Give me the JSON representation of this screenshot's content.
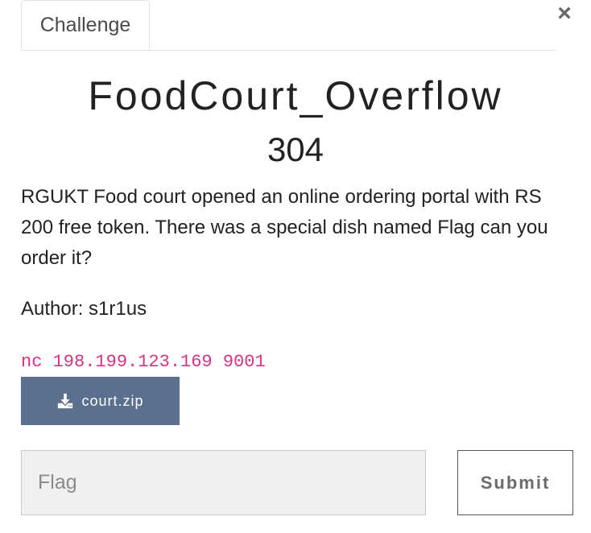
{
  "modal": {
    "tab_label": "Challenge",
    "close_icon": "×"
  },
  "challenge": {
    "name": "FoodCourt_Overflow",
    "points": "304",
    "description": "RGUKT Food court opened an online ordering portal with RS 200 free token. There was a special dish named Flag can you order it?",
    "author": "Author: s1r1us",
    "connection": "nc 198.199.123.169 9001",
    "file": {
      "icon": "download-icon",
      "name": "court.zip"
    }
  },
  "form": {
    "flag_placeholder": "Flag",
    "flag_value": "",
    "submit_label": "Submit"
  },
  "colors": {
    "download_button": "#5b6f8e",
    "connection_text": "#d63384",
    "input_background": "#f0f0f0"
  }
}
